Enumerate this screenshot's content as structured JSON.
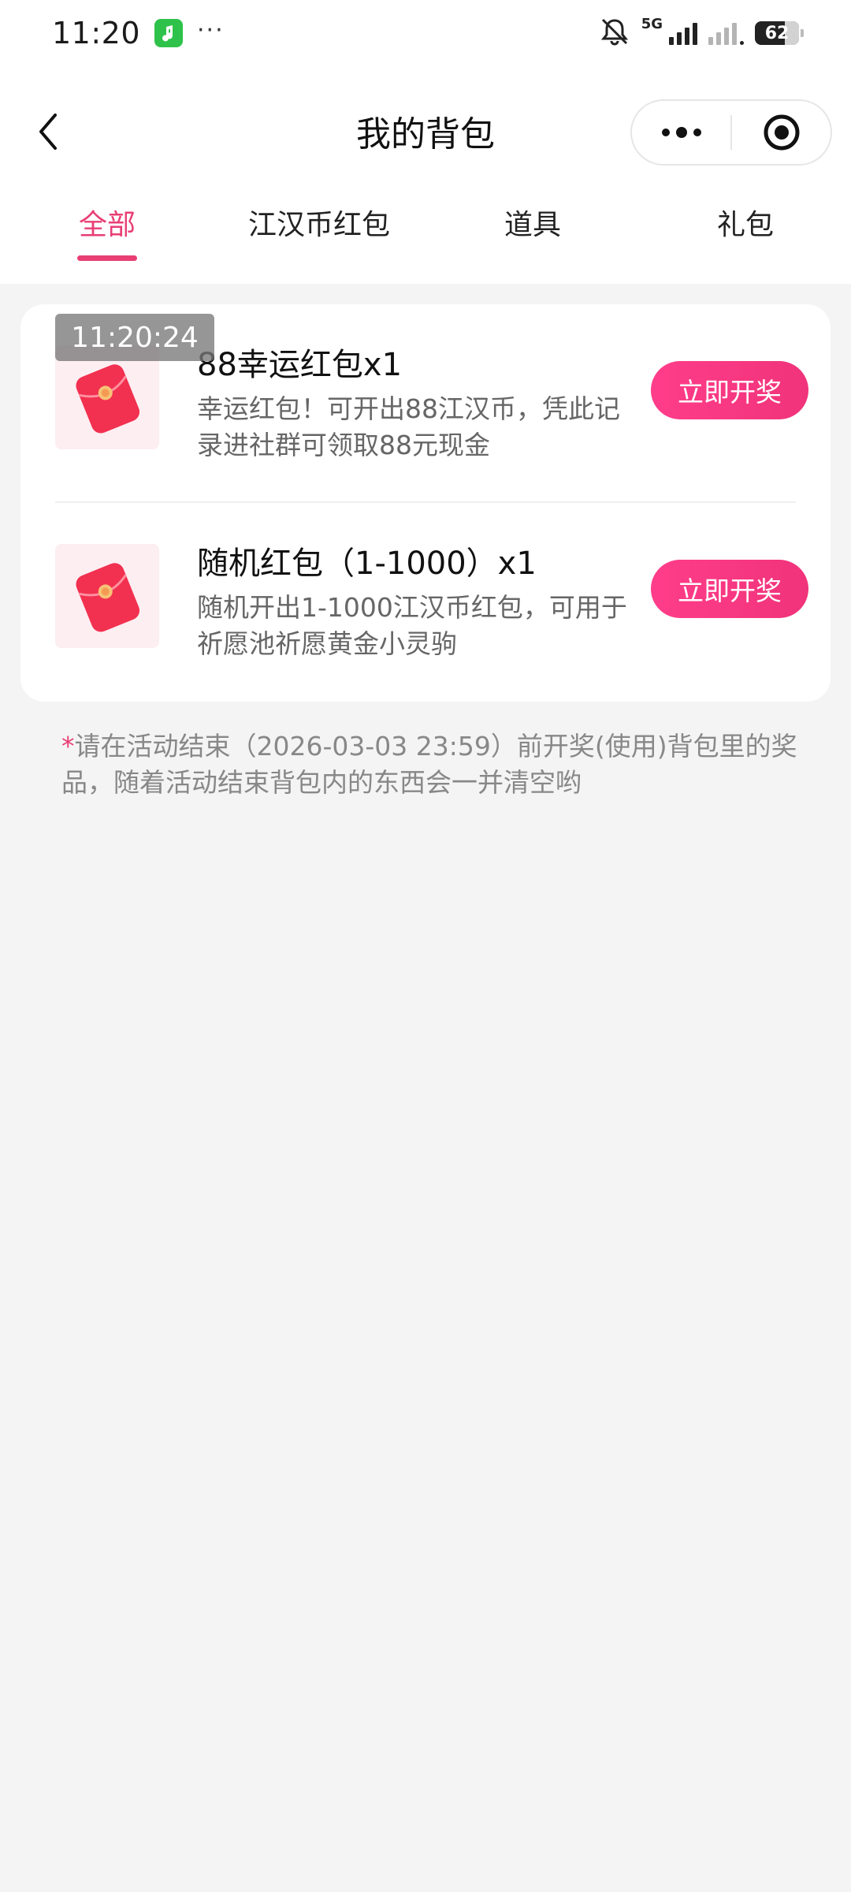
{
  "status_bar": {
    "time": "11:20",
    "more": "···",
    "network": "5G",
    "battery": "62"
  },
  "header": {
    "title": "我的背包",
    "icons": {
      "back": "chevron-left-icon",
      "more": "more-dots-icon",
      "close": "target-close-icon"
    }
  },
  "tabs": [
    {
      "label": "全部",
      "active": true
    },
    {
      "label": "江汉币红包",
      "active": false
    },
    {
      "label": "道具",
      "active": false
    },
    {
      "label": "礼包",
      "active": false
    }
  ],
  "overlay_time": "11:20:24",
  "items": [
    {
      "title": "88幸运红包x1",
      "description": "幸运红包！可开出88江汉币，凭此记录进社群可领取88元现金",
      "button": "立即开奖",
      "icon": "red-envelope-icon"
    },
    {
      "title": "随机红包（1-1000）x1",
      "description": "随机开出1-1000江汉币红包，可用于祈愿池祈愿黄金小灵驹",
      "button": "立即开奖",
      "icon": "red-envelope-icon"
    }
  ],
  "note": {
    "star": "*",
    "text": "请在活动结束（2026-03-03 23:59）前开奖(使用)背包里的奖品，随着活动结束背包内的东西会一并清空哟"
  },
  "colors": {
    "accent": "#e83e74",
    "button": "#ff3d8a",
    "background": "#f4f4f5"
  }
}
